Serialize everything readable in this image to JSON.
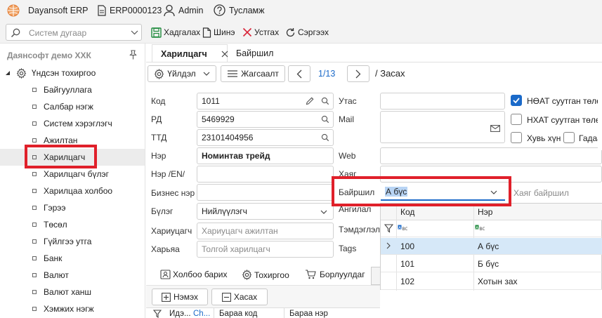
{
  "app": {
    "name": "Dayansoft ERP",
    "db": "ERP0000123",
    "user": "Admin",
    "help": "Тусламж"
  },
  "toolbar": {
    "search_placeholder": "Систем дугаар",
    "save": "Хадгалах",
    "new": "Шинэ",
    "delete": "Устгах",
    "refresh": "Сэргээх"
  },
  "sidebar": {
    "company": "Даянсофт демо ХХК",
    "root": "Үндсэн тохиргоо",
    "items": [
      "Байгууллага",
      "Салбар нэгж",
      "Систем хэрэглэгч",
      "Ажилтан",
      "Харилцагч",
      "Харилцагч бүлэг",
      "Харилцаа холбоо",
      "Гэрээ",
      "Төсөл",
      "Гүйлгээ утга",
      "Банк",
      "Валют",
      "Валют ханш",
      "Хэмжих нэгж"
    ]
  },
  "tabs": [
    "Харилцагч",
    "Байршил"
  ],
  "actions": {
    "operation": "Үйлдэл",
    "list": "Жагсаалт",
    "page": "1/13",
    "mode": "/ Засах"
  },
  "form": {
    "code_label": "Код",
    "code_value": "1011",
    "rd_label": "РД",
    "rd_value": "5469929",
    "ttd_label": "ТТД",
    "ttd_value": "23101404956",
    "name_label": "Нэр",
    "name_value": "Номинтав трейд",
    "name_en_label": "Нэр /EN/",
    "business_label": "Бизнес нэр",
    "group_label": "Бүлэг",
    "group_value": "Нийлүүлэгч",
    "owner_label": "Хариуцагч",
    "owner_placeholder": "Хариуцагч ажилтан",
    "parent_label": "Харьяа",
    "parent_placeholder": "Толгой харилцагч",
    "phone_label": "Утас",
    "mail_label": "Mail",
    "web_label": "Web",
    "address_label": "Хаяг",
    "location_label": "Байршил",
    "location_value": "А бүс",
    "location_placeholder": "Хаяг байршил",
    "category_label": "Ангилал",
    "account_label": "Тэмдэглэл",
    "tags_label": "Tags",
    "vat_payer": "НӨАТ суутган төлөгч",
    "city_tax_payer": "НХАТ суутган төлөгч",
    "individual": "Хувь хүн",
    "foreign": "Гадаад"
  },
  "grid": {
    "col_code": "Код",
    "col_name": "Нэр",
    "rows": [
      {
        "code": "100",
        "name": "А бүс"
      },
      {
        "code": "101",
        "name": "Б бүс"
      },
      {
        "code": "102",
        "name": "Хотын зах"
      }
    ]
  },
  "subtabs": [
    "Холбоо барих",
    "Тохиргоо",
    "Борлуулдаг"
  ],
  "subactions": {
    "add": "Нэмэх",
    "remove": "Хасах"
  },
  "subgrid": {
    "col1": "Идэ...",
    "col1b": "Ch...",
    "col2": "Бараа код",
    "col3": "Бараа нэр"
  },
  "colors": {
    "accent": "#1b6ac9",
    "highlight": "#e0202a",
    "selected_row": "#d6e8f8"
  }
}
